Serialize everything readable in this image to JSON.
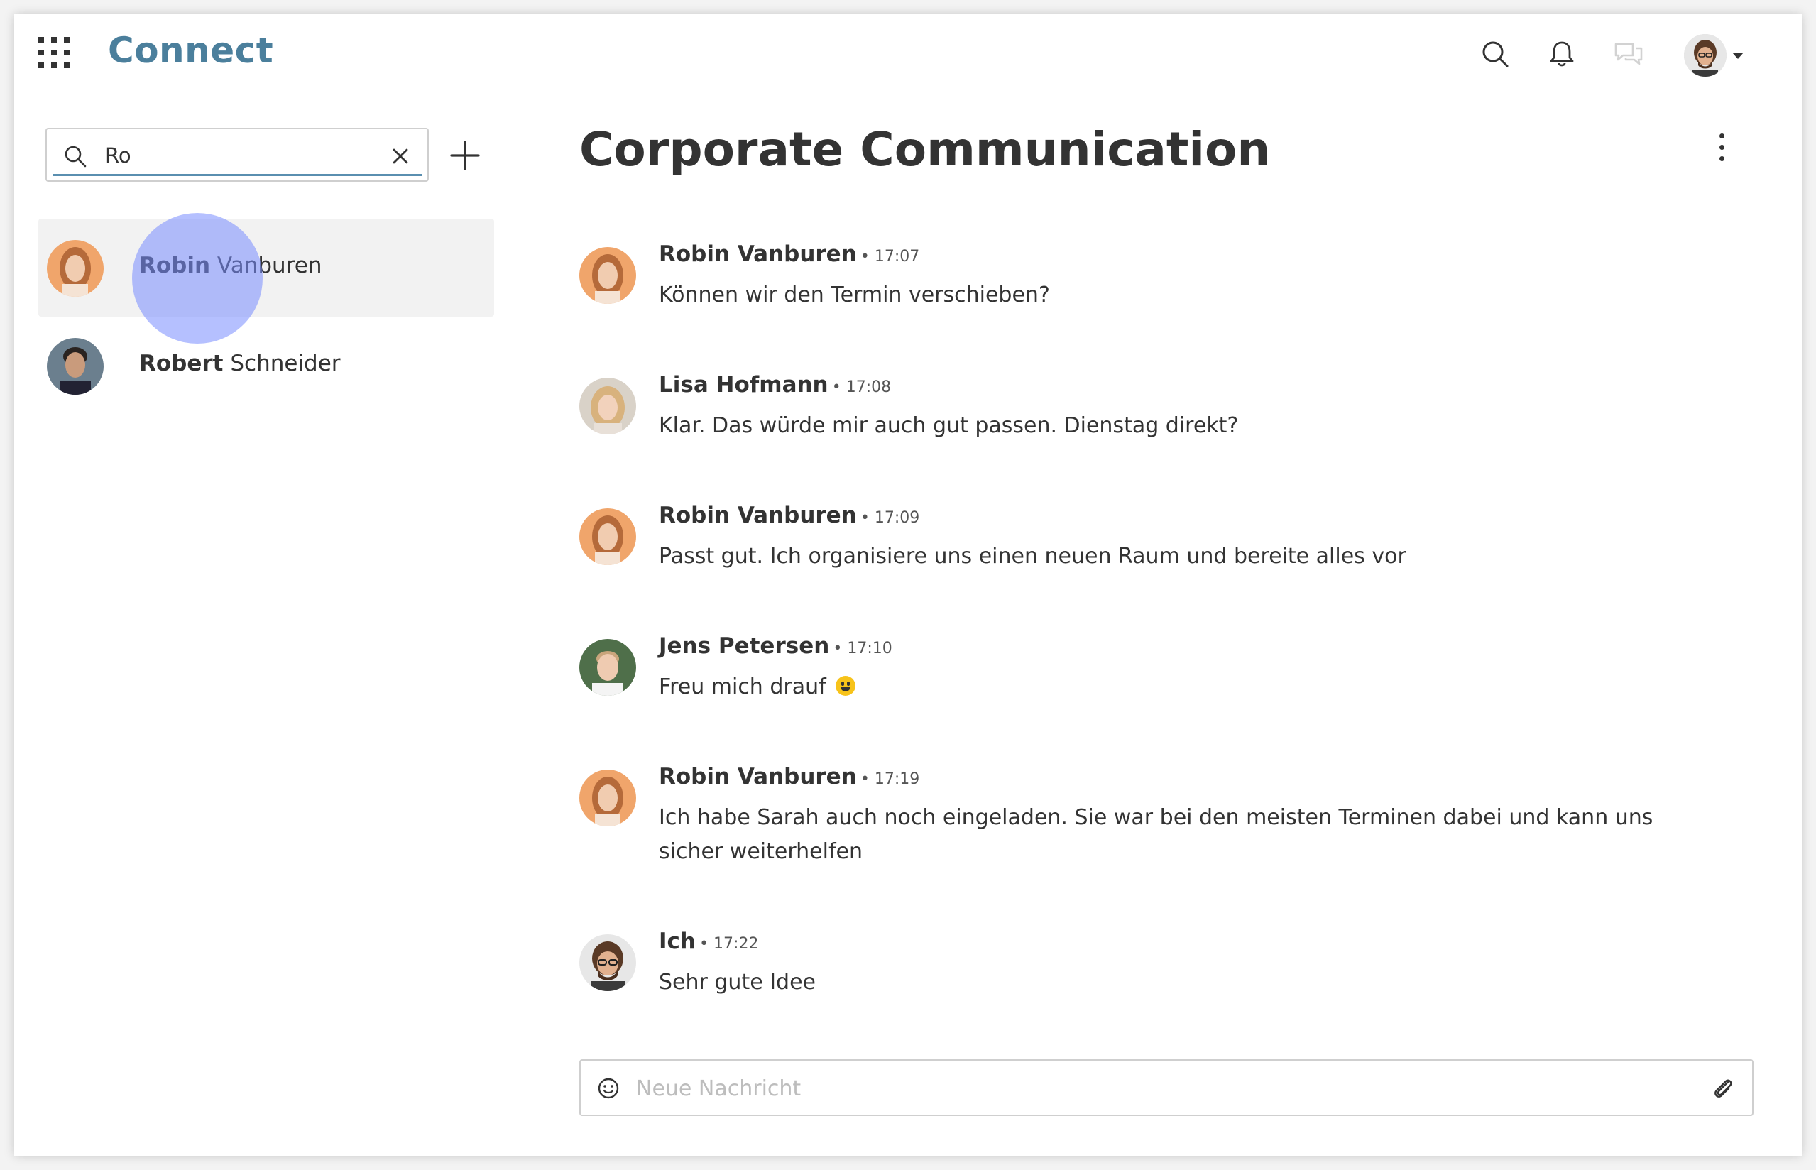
{
  "app": {
    "brand": "Connect"
  },
  "header": {
    "icons": [
      "grid-icon",
      "search-icon",
      "bell-icon",
      "chat-bubbles-icon",
      "avatar",
      "caret-down-icon"
    ]
  },
  "sidebar": {
    "search": {
      "value": "Ro",
      "placeholder": ""
    },
    "results": [
      {
        "bold": "Robin",
        "rest": " Vanburen",
        "active": true
      },
      {
        "bold": "Robert",
        "rest": " Schneider",
        "active": false
      }
    ]
  },
  "channel": {
    "title": "Corporate Communication"
  },
  "messages": [
    {
      "author": "Robin Vanburen",
      "time": "• 17:07",
      "text": "Können wir den Termin verschieben?"
    },
    {
      "author": "Lisa Hofmann",
      "time": "• 17:08",
      "text": "Klar. Das würde mir auch gut passen. Dienstag direkt?"
    },
    {
      "author": "Robin Vanburen",
      "time": "• 17:09",
      "text": "Passt gut. Ich organisiere uns einen neuen Raum und bereite alles vor"
    },
    {
      "author": "Jens Petersen",
      "time": "• 17:10",
      "text": "Freu mich drauf"
    },
    {
      "author": "Robin Vanburen",
      "time": "• 17:19",
      "text": "Ich habe Sarah auch noch eingeladen. Sie war bei den meisten Terminen dabei und kann uns sicher weiterhelfen"
    },
    {
      "author": "Ich",
      "time": "• 17:22",
      "text": "Sehr gute Idee"
    }
  ],
  "composer": {
    "placeholder": "Neue Nachricht"
  },
  "colors": {
    "brand": "#4b7f9c",
    "search_underline": "#5a8fb0",
    "click_ripple": "#788cff"
  }
}
